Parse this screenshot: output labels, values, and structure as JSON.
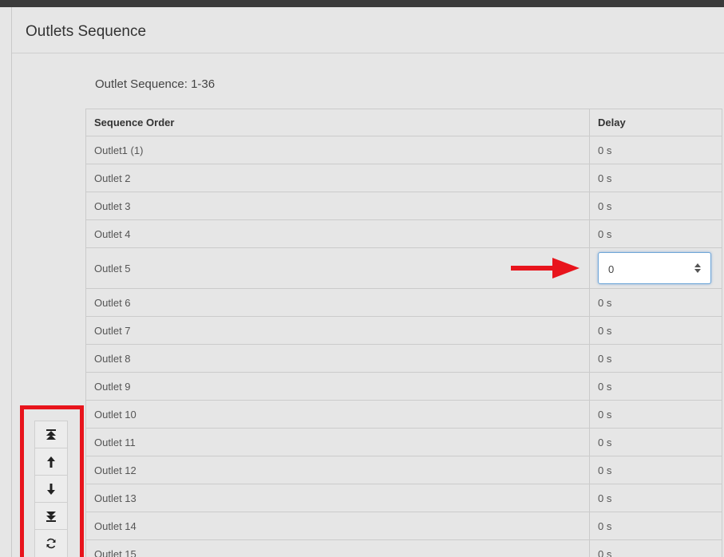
{
  "panel": {
    "title": "Outlets Sequence"
  },
  "sequence_label": "Outlet Sequence: 1-36",
  "table": {
    "headers": {
      "order": "Sequence Order",
      "delay": "Delay"
    },
    "rows": [
      {
        "outlet": "Outlet1 (1)",
        "delay": "0 s"
      },
      {
        "outlet": "Outlet 2",
        "delay": "0 s"
      },
      {
        "outlet": "Outlet 3",
        "delay": "0 s"
      },
      {
        "outlet": "Outlet 4",
        "delay": "0 s"
      },
      {
        "outlet": "Outlet 5",
        "delay_input": "0"
      },
      {
        "outlet": "Outlet 6",
        "delay": "0 s"
      },
      {
        "outlet": "Outlet 7",
        "delay": "0 s"
      },
      {
        "outlet": "Outlet 8",
        "delay": "0 s"
      },
      {
        "outlet": "Outlet 9",
        "delay": "0 s"
      },
      {
        "outlet": "Outlet 10",
        "delay": "0 s"
      },
      {
        "outlet": "Outlet 11",
        "delay": "0 s"
      },
      {
        "outlet": "Outlet 12",
        "delay": "0 s"
      },
      {
        "outlet": "Outlet 13",
        "delay": "0 s"
      },
      {
        "outlet": "Outlet 14",
        "delay": "0 s"
      },
      {
        "outlet": "Outlet 15",
        "delay": "0 s"
      }
    ]
  },
  "toolbar": {
    "buttons": [
      "move-to-top-icon",
      "move-up-icon",
      "move-down-icon",
      "move-to-bottom-icon",
      "reset-icon"
    ]
  },
  "colors": {
    "highlight": "#e8141c",
    "focus": "#6fa6d8"
  }
}
